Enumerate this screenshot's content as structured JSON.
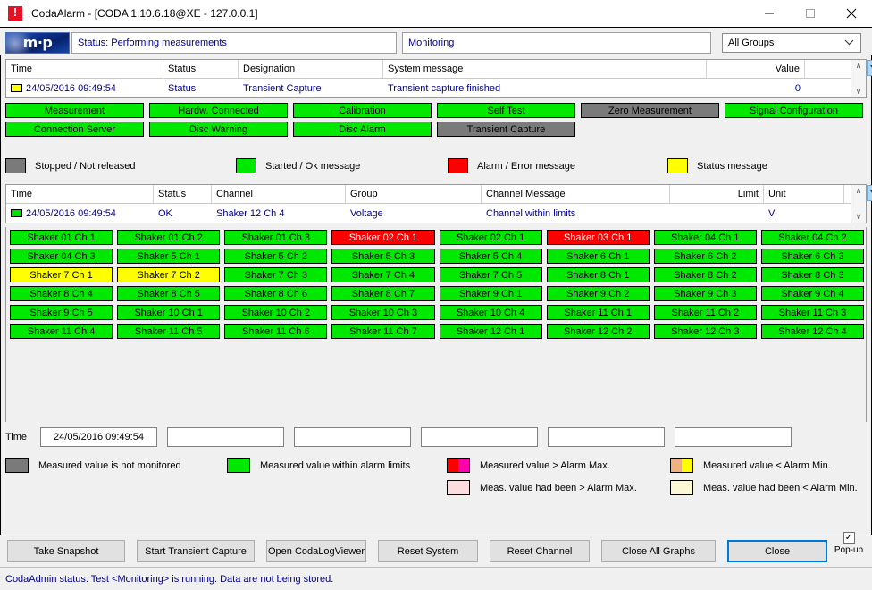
{
  "window": {
    "title": "CodaAlarm - [CODA 1.10.6.18@XE - 127.0.0.1]",
    "minimize": "—",
    "maximize": "□",
    "close": "✕"
  },
  "header": {
    "logo_text": "m·p",
    "status_text": "Status: Performing measurements",
    "monitoring_text": "Monitoring",
    "group_filter": "All Groups",
    "chevron": "⌄"
  },
  "system_log": {
    "columns": [
      "Time",
      "Status",
      "Designation",
      "System message",
      "Value"
    ],
    "rows": [
      {
        "swatch": "yellow",
        "time": "24/05/2016 09:49:54",
        "status": "Status",
        "designation": "Transient Capture",
        "message": "Transient capture finished",
        "value": "0"
      }
    ],
    "scroll_up": "∧",
    "scroll_down": "∨",
    "side_button": "▼"
  },
  "system_buttons": {
    "row1": [
      {
        "label": "Measurement",
        "state": "green"
      },
      {
        "label": "Hardw. Connected",
        "state": "green"
      },
      {
        "label": "Calibration",
        "state": "green"
      },
      {
        "label": "Self Test",
        "state": "green"
      },
      {
        "label": "Zero Measurement",
        "state": "gray"
      },
      {
        "label": "Signal Configuration",
        "state": "green"
      }
    ],
    "row2": [
      {
        "label": "Connection Server",
        "state": "green"
      },
      {
        "label": "Disc Warning",
        "state": "green"
      },
      {
        "label": "Disc Alarm",
        "state": "green"
      },
      {
        "label": "Transient Capture",
        "state": "gray"
      }
    ]
  },
  "status_legend": [
    {
      "color": "gray",
      "label": "Stopped / Not released"
    },
    {
      "color": "green",
      "label": "Started / Ok message"
    },
    {
      "color": "red",
      "label": "Alarm / Error message"
    },
    {
      "color": "yellow",
      "label": "Status message"
    }
  ],
  "channel_log": {
    "columns": [
      "Time",
      "Status",
      "Channel",
      "Group",
      "Channel Message",
      "Limit",
      "Unit"
    ],
    "rows": [
      {
        "swatch": "green",
        "time": "24/05/2016 09:49:54",
        "status": "OK",
        "channel": "Shaker 12 Ch 4",
        "group": "Voltage",
        "message": "Channel within limits",
        "limit": "",
        "unit": "V"
      }
    ],
    "scroll_up": "∧",
    "scroll_down": "∨",
    "side_button": "▼"
  },
  "channels": [
    {
      "label": "Shaker 01 Ch 1",
      "state": "green"
    },
    {
      "label": "Shaker 01 Ch 2",
      "state": "green"
    },
    {
      "label": "Shaker 01 Ch 3",
      "state": "green"
    },
    {
      "label": "Shaker 02 Ch 1",
      "state": "red"
    },
    {
      "label": "Shaker 02 Ch 1",
      "state": "green"
    },
    {
      "label": "Shaker 03 Ch 1",
      "state": "red"
    },
    {
      "label": "Shaker 04 Ch 1",
      "state": "green"
    },
    {
      "label": "Shaker 04 Ch 2",
      "state": "green"
    },
    {
      "label": "Shaker 04 Ch 3",
      "state": "green"
    },
    {
      "label": "Shaker 5 Ch 1",
      "state": "green"
    },
    {
      "label": "Shaker 5 Ch 2",
      "state": "green"
    },
    {
      "label": "Shaker 5 Ch 3",
      "state": "green"
    },
    {
      "label": "Shaker 5 Ch 4",
      "state": "green"
    },
    {
      "label": "Shaker 6 Ch 1",
      "state": "green"
    },
    {
      "label": "Shaker 6 Ch 2",
      "state": "green"
    },
    {
      "label": "Shaker 6 Ch 3",
      "state": "green"
    },
    {
      "label": "Shaker 7 Ch 1",
      "state": "yellow"
    },
    {
      "label": "Shaker 7 Ch 2",
      "state": "yellow"
    },
    {
      "label": "Shaker 7 Ch 3",
      "state": "green"
    },
    {
      "label": "Shaker 7 Ch 4",
      "state": "green"
    },
    {
      "label": "Shaker 7 Ch 5",
      "state": "green"
    },
    {
      "label": "Shaker 8 Ch 1",
      "state": "green"
    },
    {
      "label": "Shaker 8 Ch 2",
      "state": "green"
    },
    {
      "label": "Shaker 8 Ch 3",
      "state": "green"
    },
    {
      "label": "Shaker 8 Ch 4",
      "state": "green"
    },
    {
      "label": "Shaker 8 Ch 5",
      "state": "green"
    },
    {
      "label": "Shaker 8 Ch 6",
      "state": "green"
    },
    {
      "label": "Shaker 8 Ch 7",
      "state": "green"
    },
    {
      "label": "Shaker 9 Ch 1",
      "state": "green"
    },
    {
      "label": "Shaker 9 Ch 2",
      "state": "green"
    },
    {
      "label": "Shaker 9 Ch 3",
      "state": "green"
    },
    {
      "label": "Shaker 9 Ch 4",
      "state": "green"
    },
    {
      "label": "Shaker 9 Ch 5",
      "state": "green"
    },
    {
      "label": "Shaker 10 Ch 1",
      "state": "green"
    },
    {
      "label": "Shaker 10 Ch 2",
      "state": "green"
    },
    {
      "label": "Shaker 10 Ch 3",
      "state": "green"
    },
    {
      "label": "Shaker 10 Ch 4",
      "state": "green"
    },
    {
      "label": "Shaker 11 Ch 1",
      "state": "green"
    },
    {
      "label": "Shaker 11 Ch 2",
      "state": "green"
    },
    {
      "label": "Shaker 11 Ch 3",
      "state": "green"
    },
    {
      "label": "Shaker 11 Ch 4",
      "state": "green"
    },
    {
      "label": "Shaker 11 Ch 5",
      "state": "green"
    },
    {
      "label": "Shaker 11 Ch 6",
      "state": "green"
    },
    {
      "label": "Shaker 11 Ch 7",
      "state": "green"
    },
    {
      "label": "Shaker 12 Ch 1",
      "state": "green"
    },
    {
      "label": "Shaker 12 Ch 2",
      "state": "green"
    },
    {
      "label": "Shaker 12 Ch 3",
      "state": "green"
    },
    {
      "label": "Shaker 12 Ch 4",
      "state": "green"
    }
  ],
  "time_row": {
    "label": "Time",
    "values": [
      "24/05/2016 09:49:54",
      "",
      "",
      "",
      "",
      ""
    ]
  },
  "alarm_legend": [
    {
      "swatch": "gray",
      "label": "Measured value is not monitored"
    },
    {
      "swatch": "green",
      "label": "Measured value within alarm limits"
    },
    {
      "swatch": "split-redmag",
      "label": "Measured value > Alarm Max."
    },
    {
      "swatch": "split-orgyel",
      "label": "Measured value < Alarm Min."
    },
    {
      "swatch": "pinkdot",
      "label": "Meas. value had been > Alarm Max."
    },
    {
      "swatch": "cream",
      "label": "Meas. value had been < Alarm Min."
    }
  ],
  "buttons": [
    "Take Snapshot",
    "Start Transient Capture",
    "Open CodaLogViewer",
    "Reset System",
    "Reset Channel",
    "Close All Graphs",
    "Close"
  ],
  "popup": {
    "checked": "✓",
    "label": "Pop-up"
  },
  "statusbar": {
    "text": "CodaAdmin status: Test <Monitoring> is running. Data are not being stored."
  },
  "colors": {
    "ok_green": "#00e800",
    "alarm_red": "#ff0000",
    "status_yellow": "#ffff00",
    "not_released_gray": "#7a7a7a",
    "link_blue": "#00008B",
    "accent_blue": "#0078d7"
  }
}
